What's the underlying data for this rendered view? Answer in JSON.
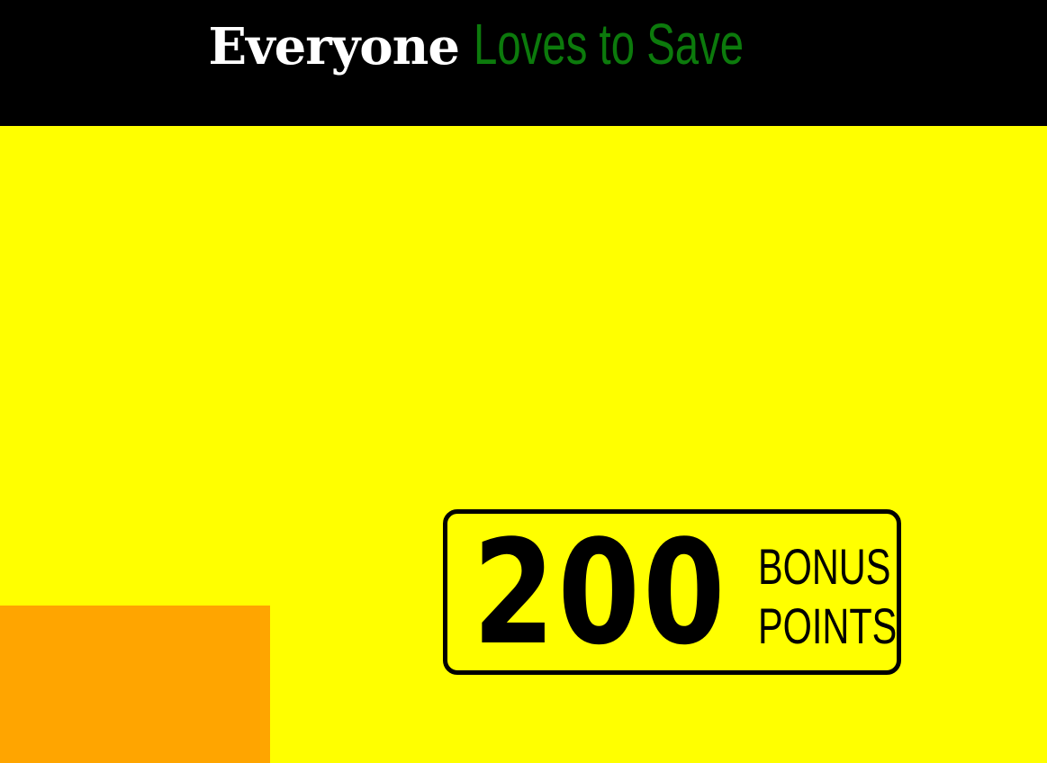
{
  "header": {
    "headline_part1": "Everyone",
    "headline_part2": "Loves to Save",
    "background_color": "#000000",
    "part1_color": "#ffffff",
    "part2_color": "#0c7a0c"
  },
  "page": {
    "background_color": "#ffff00"
  },
  "badge": {
    "number": "200",
    "label_line1": "BONUS",
    "label_line2": "POINTS"
  },
  "orange_block": {
    "color": "#ffa500"
  }
}
